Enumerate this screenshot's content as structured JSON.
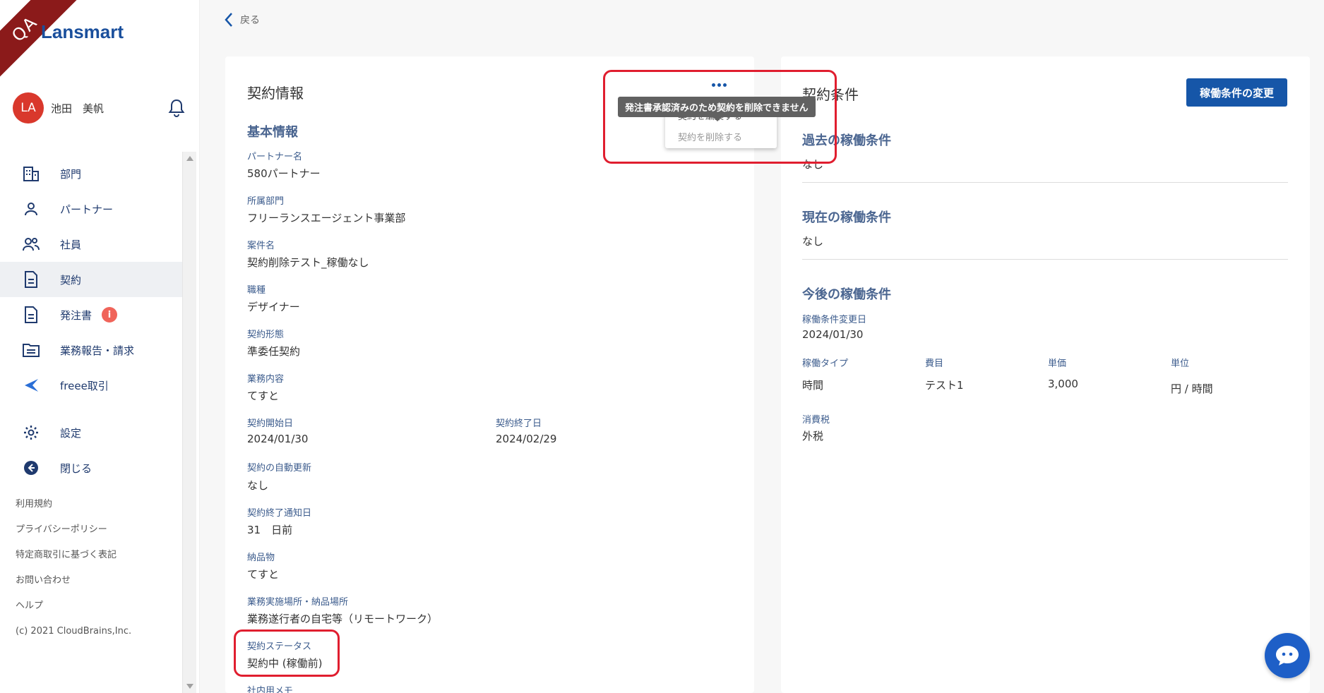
{
  "qa_label": "QA",
  "logo": "Lansmart",
  "user": {
    "initials": "LA",
    "name": "池田　美帆"
  },
  "nav": [
    {
      "label": "部門"
    },
    {
      "label": "パートナー"
    },
    {
      "label": "社員"
    },
    {
      "label": "契約"
    },
    {
      "label": "発注書",
      "badge": "i"
    },
    {
      "label": "業務報告・請求"
    },
    {
      "label": "freee取引"
    },
    {
      "label": "設定"
    },
    {
      "label": "閉じる"
    }
  ],
  "footer": [
    "利用規約",
    "プライバシーポリシー",
    "特定商取引に基づく表記",
    "お問い合わせ",
    "ヘルプ",
    "(c) 2021 CloudBrains,Inc."
  ],
  "back_label": "戻る",
  "contract_info": {
    "title": "契約情報",
    "section": "基本情報",
    "fields": {
      "partner_label": "パートナー名",
      "partner_value": "580パートナー",
      "dept_label": "所属部門",
      "dept_value": "フリーランスエージェント事業部",
      "project_label": "案件名",
      "project_value": "契約削除テスト_稼働なし",
      "job_label": "職種",
      "job_value": "デザイナー",
      "form_label": "契約形態",
      "form_value": "準委任契約",
      "content_label": "業務内容",
      "content_value": "てすと",
      "start_label": "契約開始日",
      "start_value": "2024/01/30",
      "end_label": "契約終了日",
      "end_value": "2024/02/29",
      "renew_label": "契約の自動更新",
      "renew_value": "なし",
      "notice_label": "契約終了通知日",
      "notice_value": "31　日前",
      "deliver_label": "納品物",
      "deliver_value": "てすと",
      "place_label": "業務実施場所・納品場所",
      "place_value": "業務遂行者の自宅等（リモートワーク）",
      "status_label": "契約ステータス",
      "status_value": "契約中 (稼働前)",
      "memo_label": "社内用メモ"
    },
    "menu": {
      "item1": "契約を編集する",
      "item2": "契約を削除する"
    },
    "tooltip": "発注書承認済みのため契約を削除できません"
  },
  "conditions": {
    "title": "契約条件",
    "change_button": "稼働条件の変更",
    "past_title": "過去の稼働条件",
    "past_value": "なし",
    "current_title": "現在の稼働条件",
    "current_value": "なし",
    "future_title": "今後の稼働条件",
    "change_date_label": "稼働条件変更日",
    "change_date_value": "2024/01/30",
    "cols": {
      "type": "稼働タイプ",
      "item": "費目",
      "price": "単価",
      "unit": "単位"
    },
    "row": {
      "type": "時間",
      "item": "テスト1",
      "price": "3,000",
      "unit": "円 / 時間"
    },
    "tax_label": "消費税",
    "tax_value": "外税"
  },
  "colors": {
    "accent": "#1656a8",
    "highlight": "#e01e2f",
    "label": "#3b5b8c"
  }
}
